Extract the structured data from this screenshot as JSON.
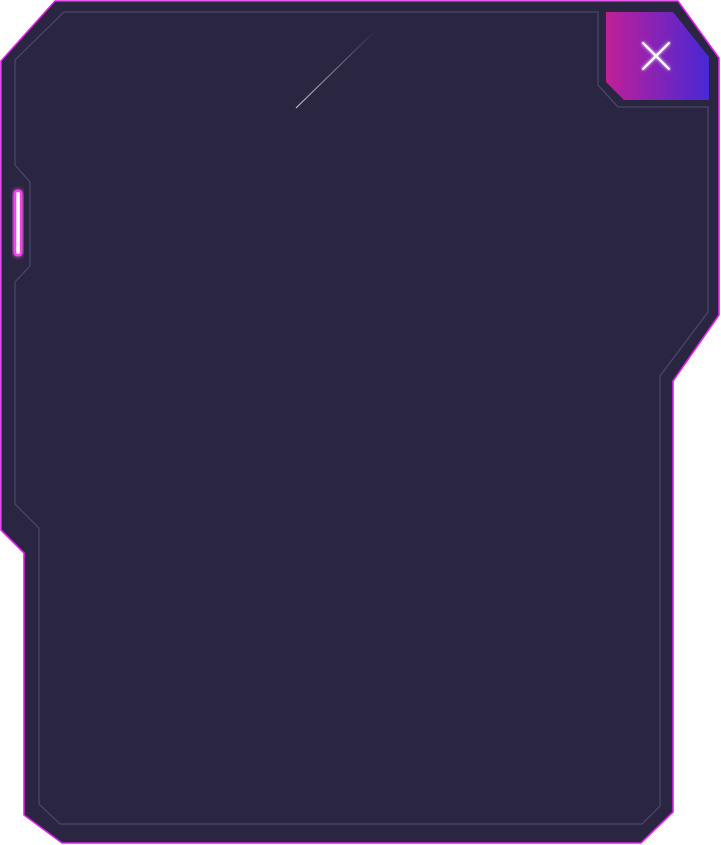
{
  "dialog": {
    "close_icon": "close-icon",
    "colors": {
      "panel_fill": "#2a2541",
      "outer_border": "#e020e8",
      "inner_border": "#4b4870",
      "close_gradient_start": "#c01f98",
      "close_gradient_end": "#4828d4",
      "glow_tab": "#ff3cf0",
      "highlight_line": "#dcdce6",
      "close_glyph": "#ffffff"
    }
  }
}
